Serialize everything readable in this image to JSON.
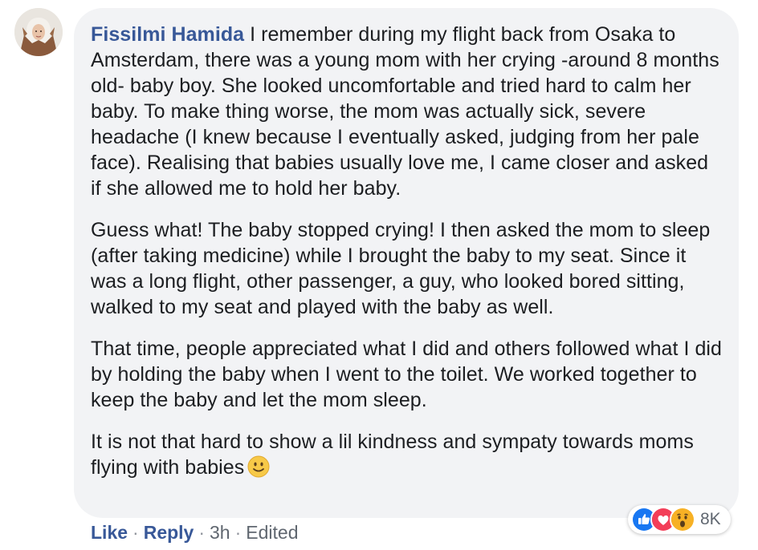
{
  "comment": {
    "author": "Fissilmi Hamida",
    "paragraphs": [
      "I remember during my flight back from Osaka to Amsterdam, there was a young mom with her crying -around 8 months old- baby boy. She looked uncomfortable and tried hard to calm her baby. To make thing worse, the mom was actually sick, severe headache (I knew because I eventually asked, judging from her pale face). Realising that babies usually love me, I came closer and asked if she allowed me to hold her baby.",
      "Guess what! The baby stopped crying! I then asked the mom to sleep (after taking medicine) while I brought the baby to my seat. Since it was a long flight, other passenger, a guy, who looked bored sitting, walked to my seat and played with the baby as well.",
      "That time, people appreciated what I did and others followed what I did by holding the baby when I went to the toilet. We worked together to keep the baby and let the mom sleep.",
      "It is not that hard to show a lil kindness and sympaty towards moms flying with babies"
    ],
    "trailing_emoji": "smiling-face-emoji"
  },
  "reactions": {
    "icons": [
      "like-icon",
      "love-icon",
      "wow-icon"
    ],
    "count": "8K"
  },
  "actions": {
    "like_label": "Like",
    "reply_label": "Reply",
    "time": "3h",
    "edited_label": "Edited",
    "separator": "·"
  },
  "colors": {
    "bubble": "#f2f3f5",
    "author": "#385898",
    "text": "#1c1e21",
    "meta": "#606770",
    "like": "#1877f2",
    "love": "#f33e58",
    "wow": "#f7b125"
  }
}
